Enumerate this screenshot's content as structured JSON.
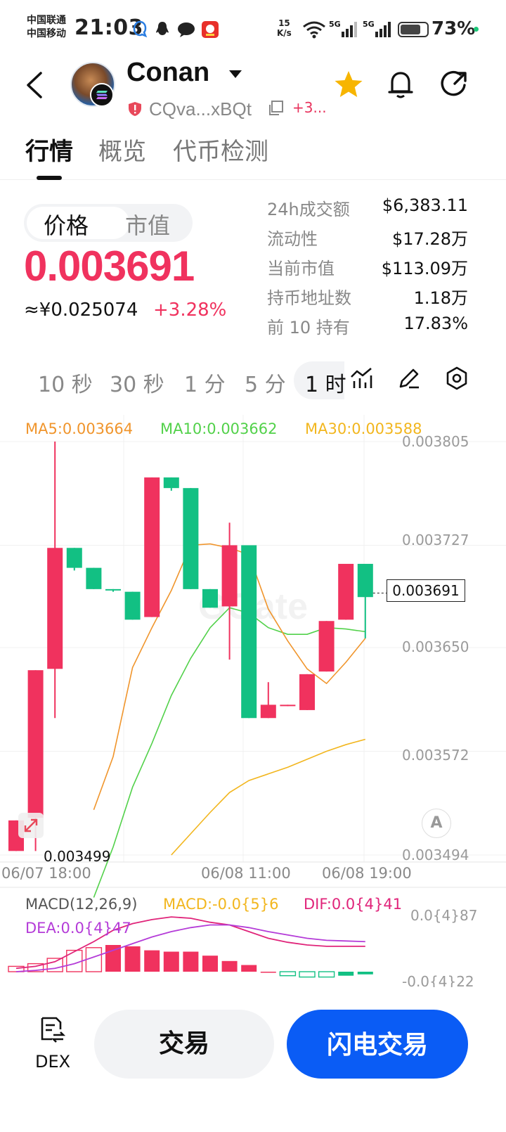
{
  "status_bar": {
    "carrier1": "中国联通",
    "carrier2": "中国移动",
    "time": "21:03",
    "net_speed_value": "15",
    "net_speed_unit": "K/s",
    "signal1_label": "5G",
    "signal2_label": "5G",
    "battery": "73%"
  },
  "header": {
    "token_name": "Conan",
    "address": "CQva...xBQt",
    "more_chains": "+3...",
    "icons": [
      "back-arrow-icon",
      "star-icon",
      "bell-icon",
      "share-icon"
    ],
    "star_color": "#f7b500"
  },
  "tabs": [
    {
      "label": "行情",
      "active": true
    },
    {
      "label": "概览",
      "active": false
    },
    {
      "label": "代币检测",
      "active": false
    }
  ],
  "price_block": {
    "toggle": [
      "价格",
      "市值"
    ],
    "price": "0.003691",
    "cny_price": "≈¥0.025074",
    "change": "+3.28%",
    "up_color": "#f0325e"
  },
  "stats": [
    {
      "label": "24h成交额",
      "value": "$6,383.11"
    },
    {
      "label": "流动性",
      "value": "$17.28万"
    },
    {
      "label": "当前市值",
      "value": "$113.09万"
    },
    {
      "label": "持币地址数",
      "value": "1.18万"
    },
    {
      "label": "前 10 持有",
      "value": "17.83%"
    }
  ],
  "timeframes": [
    {
      "label": "10 秒",
      "active": false
    },
    {
      "label": "30 秒",
      "active": false
    },
    {
      "label": "1 分",
      "active": false
    },
    {
      "label": "5 分",
      "active": false
    },
    {
      "label": "1 时",
      "active": true
    }
  ],
  "chart": {
    "ma5": "MA5:0.003664",
    "ma10": "MA10:0.003662",
    "ma30": "MA30:0.003588",
    "y_ticks": [
      "0.003805",
      "0.003727",
      "0.003650",
      "0.003572",
      "0.003494"
    ],
    "current_price": "0.003691",
    "low_label": "0.003499",
    "x_ticks": [
      "06/07 18:00",
      "06/08 11:00",
      "06/08 19:00"
    ],
    "a_button": "A",
    "macd_title": "MACD(12,26,9)",
    "macd_value": "MACD:-0.0{5}6",
    "dif_value": "DIF:0.0{4}41",
    "dea_value": "DEA:0.0{4}47",
    "macd_y_top": "0.0{4}87",
    "macd_y_bottom": "-0.0{4}22",
    "colors": {
      "up": "#f0325e",
      "down": "#12c083",
      "ma5": "#f0952c",
      "ma10": "#52d14a",
      "ma30": "#f2b61e",
      "dif": "#e0247a",
      "dea": "#b43cd8"
    }
  },
  "chart_data": {
    "type": "candlestick",
    "ylim": [
      0.003494,
      0.003805
    ],
    "y_ticks": [
      0.003805,
      0.003727,
      0.00365,
      0.003572,
      0.003494
    ],
    "candles": [
      {
        "open": 0.003497,
        "close": 0.00352,
        "high": 0.00352,
        "low": 0.003497
      },
      {
        "open": 0.003522,
        "close": 0.003633,
        "high": 0.003633,
        "low": 0.003497
      },
      {
        "open": 0.003634,
        "close": 0.003725,
        "high": 0.003805,
        "low": 0.003597
      },
      {
        "open": 0.003725,
        "close": 0.00371,
        "high": 0.003725,
        "low": 0.003708
      },
      {
        "open": 0.00371,
        "close": 0.003694,
        "high": 0.00371,
        "low": 0.003694
      },
      {
        "open": 0.003694,
        "close": 0.003693,
        "high": 0.003694,
        "low": 0.003692
      },
      {
        "open": 0.003692,
        "close": 0.003671,
        "high": 0.003692,
        "low": 0.003671
      },
      {
        "open": 0.003673,
        "close": 0.003778,
        "high": 0.003778,
        "low": 0.003673
      },
      {
        "open": 0.003778,
        "close": 0.00377,
        "high": 0.003778,
        "low": 0.003768
      },
      {
        "open": 0.00377,
        "close": 0.003694,
        "high": 0.00377,
        "low": 0.003694
      },
      {
        "open": 0.003694,
        "close": 0.00368,
        "high": 0.003694,
        "low": 0.00368
      },
      {
        "open": 0.003681,
        "close": 0.003727,
        "high": 0.003744,
        "low": 0.003641
      },
      {
        "open": 0.003727,
        "close": 0.003597,
        "high": 0.003727,
        "low": 0.003597
      },
      {
        "open": 0.003597,
        "close": 0.003607,
        "high": 0.003624,
        "low": 0.003597
      },
      {
        "open": 0.003606,
        "close": 0.003607,
        "high": 0.003607,
        "low": 0.003606
      },
      {
        "open": 0.003603,
        "close": 0.00363,
        "high": 0.00363,
        "low": 0.003603
      },
      {
        "open": 0.003632,
        "close": 0.00367,
        "high": 0.00367,
        "low": 0.003632
      },
      {
        "open": 0.003671,
        "close": 0.003713,
        "high": 0.003713,
        "low": 0.003671
      },
      {
        "open": 0.003713,
        "close": 0.003688,
        "high": 0.003713,
        "low": 0.003657
      }
    ],
    "current_price": 0.003691,
    "low_marker": 0.003499,
    "x_ticks": [
      "06/07 18:00",
      "06/08 11:00",
      "06/08 19:00"
    ],
    "ma5": [
      null,
      null,
      null,
      null,
      0.003528,
      0.003568,
      0.003635,
      0.003665,
      0.003693,
      0.003727,
      0.003728,
      0.003725,
      0.00372,
      0.003679,
      0.003655,
      0.003634,
      0.003623,
      0.003639,
      0.003657
    ],
    "ma10": [
      null,
      null,
      null,
      null,
      0.003462,
      0.0035,
      0.003545,
      0.003578,
      0.003614,
      0.003642,
      0.003665,
      0.00368,
      0.003676,
      0.003665,
      0.00366,
      0.00366,
      0.003665,
      0.003664,
      0.003662
    ],
    "ma30": [
      null,
      null,
      null,
      null,
      null,
      null,
      null,
      null,
      0.003494,
      0.00351,
      0.003526,
      0.003541,
      0.00355,
      0.003555,
      0.00356,
      0.003566,
      0.003572,
      0.003577,
      0.003581
    ],
    "macd_hist": [
      0.08,
      0.12,
      0.2,
      0.32,
      0.36,
      0.4,
      0.38,
      0.32,
      0.3,
      0.3,
      0.24,
      0.16,
      0.1,
      0.0,
      -0.06,
      -0.08,
      -0.08,
      -0.06,
      -0.04
    ]
  }
}
